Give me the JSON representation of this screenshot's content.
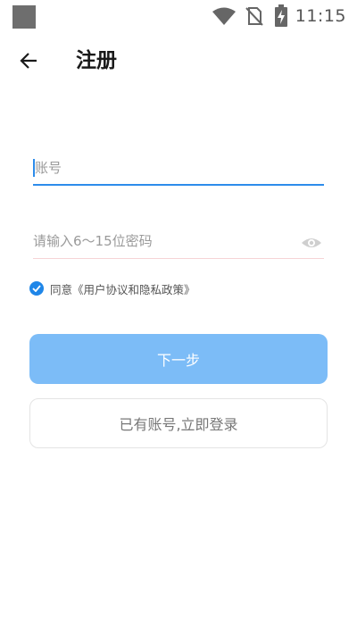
{
  "status_bar": {
    "time": "11:15",
    "icons": [
      "app-notification-icon",
      "wifi-icon",
      "no-sim-icon",
      "battery-charging-icon"
    ]
  },
  "header": {
    "back_icon": "arrow-left-icon",
    "title": "注册"
  },
  "form": {
    "account": {
      "placeholder": "账号",
      "value": ""
    },
    "password": {
      "placeholder": "请输入6～15位密码",
      "value": "",
      "toggle_icon": "eye-icon"
    },
    "agreement": {
      "checked": true,
      "prefix": "同意",
      "link_text": "《用户协议和隐私政策》"
    }
  },
  "buttons": {
    "next_label": "下一步",
    "login_label": "已有账号,立即登录"
  },
  "colors": {
    "accent": "#2d8ceb",
    "primary_button": "#7cbcf7",
    "error_underline": "#f6d4d6"
  }
}
